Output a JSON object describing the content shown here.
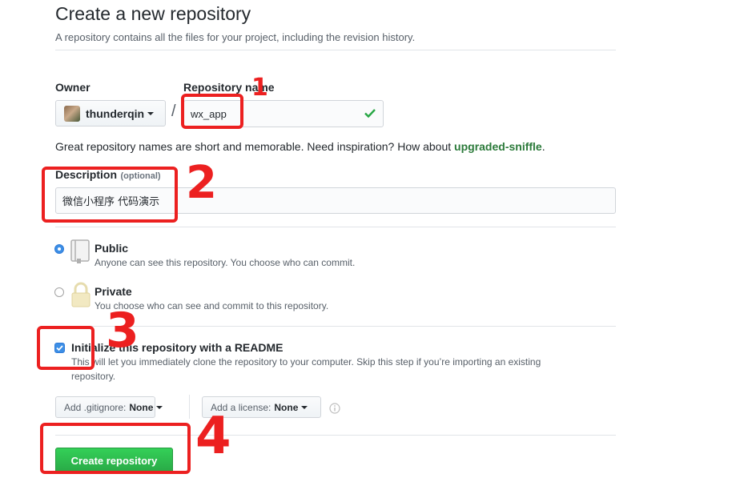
{
  "header": {
    "title": "Create a new repository",
    "subtitle": "A repository contains all the files for your project, including the revision history."
  },
  "owner": {
    "label": "Owner",
    "username": "thunderqin"
  },
  "separator": "/",
  "repository": {
    "label": "Repository name",
    "value": "wx_app"
  },
  "suggestion": {
    "prefix": "Great repository names are short and memorable. Need inspiration? How about ",
    "name": "upgraded-sniffle",
    "suffix": "."
  },
  "description": {
    "label": "Description",
    "optional": "(optional)",
    "value": "微信小程序 代码演示"
  },
  "visibility": {
    "public": {
      "label": "Public",
      "desc": "Anyone can see this repository. You choose who can commit.",
      "checked": true
    },
    "private": {
      "label": "Private",
      "desc": "You choose who can see and commit to this repository.",
      "checked": false
    }
  },
  "init_readme": {
    "label": "Initialize this repository with a README",
    "desc_line1": "This will let you immediately clone the repository to your computer. Skip this step if you’re importing an existing",
    "desc_line2": "repository.",
    "checked": true
  },
  "gitignore": {
    "prefix": "Add .gitignore:",
    "value": "None"
  },
  "license": {
    "prefix": "Add a license:",
    "value": "None"
  },
  "submit": {
    "label": "Create repository"
  },
  "annotations": [
    "1",
    "2",
    "3",
    "4"
  ],
  "colors": {
    "annotation": "#ec2020",
    "submit_green": "#2cbe4e",
    "checkmark": "#28a745",
    "suggestion": "#2b7a3a"
  }
}
